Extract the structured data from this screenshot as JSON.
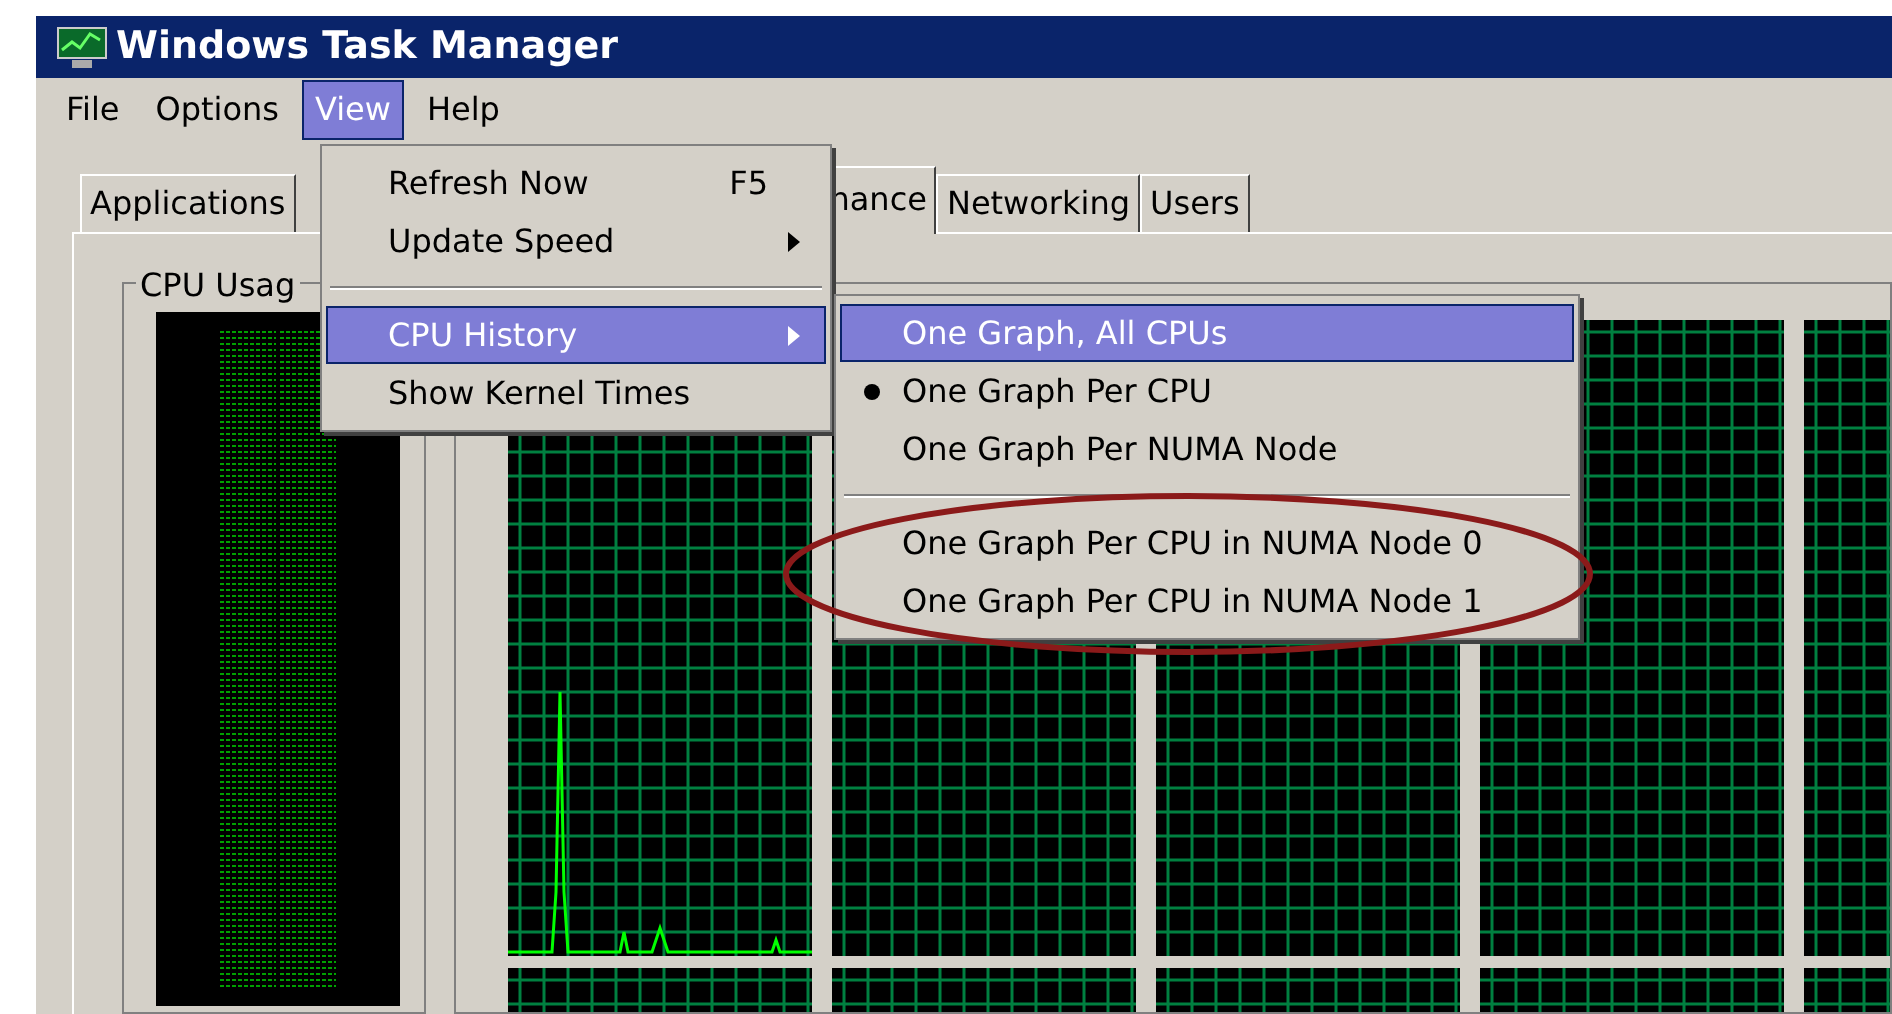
{
  "window": {
    "title": "Windows Task Manager"
  },
  "menu_bar": [
    {
      "label": "File",
      "selected": false
    },
    {
      "label": "Options",
      "selected": false
    },
    {
      "label": "View",
      "selected": true
    },
    {
      "label": "Help",
      "selected": false
    }
  ],
  "tabs": [
    {
      "label": "Applications",
      "selected": false
    },
    {
      "label": "nance",
      "selected": true
    },
    {
      "label": "Networking",
      "selected": false
    },
    {
      "label": "Users",
      "selected": false
    }
  ],
  "cpu_usage_group": {
    "label": "CPU Usag"
  },
  "view_menu": [
    {
      "kind": "item",
      "label": "Refresh Now",
      "shortcut": "F5",
      "submenu": false,
      "selected": false
    },
    {
      "kind": "item",
      "label": "Update Speed",
      "submenu": true,
      "selected": false
    },
    {
      "kind": "separator"
    },
    {
      "kind": "item",
      "label": "CPU History",
      "submenu": true,
      "selected": true
    },
    {
      "kind": "item",
      "label": "Show Kernel Times",
      "submenu": false,
      "selected": false
    }
  ],
  "cpu_history_submenu": [
    {
      "kind": "item",
      "label": "One Graph, All CPUs",
      "checked": false,
      "selected": true
    },
    {
      "kind": "item",
      "label": "One Graph Per CPU",
      "checked": true,
      "selected": false
    },
    {
      "kind": "item",
      "label": "One Graph Per NUMA Node",
      "checked": false,
      "selected": false
    },
    {
      "kind": "separator"
    },
    {
      "kind": "item",
      "label": "One Graph Per CPU in NUMA Node 0",
      "checked": false,
      "selected": false
    },
    {
      "kind": "item",
      "label": "One Graph Per CPU in NUMA Node 1",
      "checked": false,
      "selected": false
    }
  ]
}
